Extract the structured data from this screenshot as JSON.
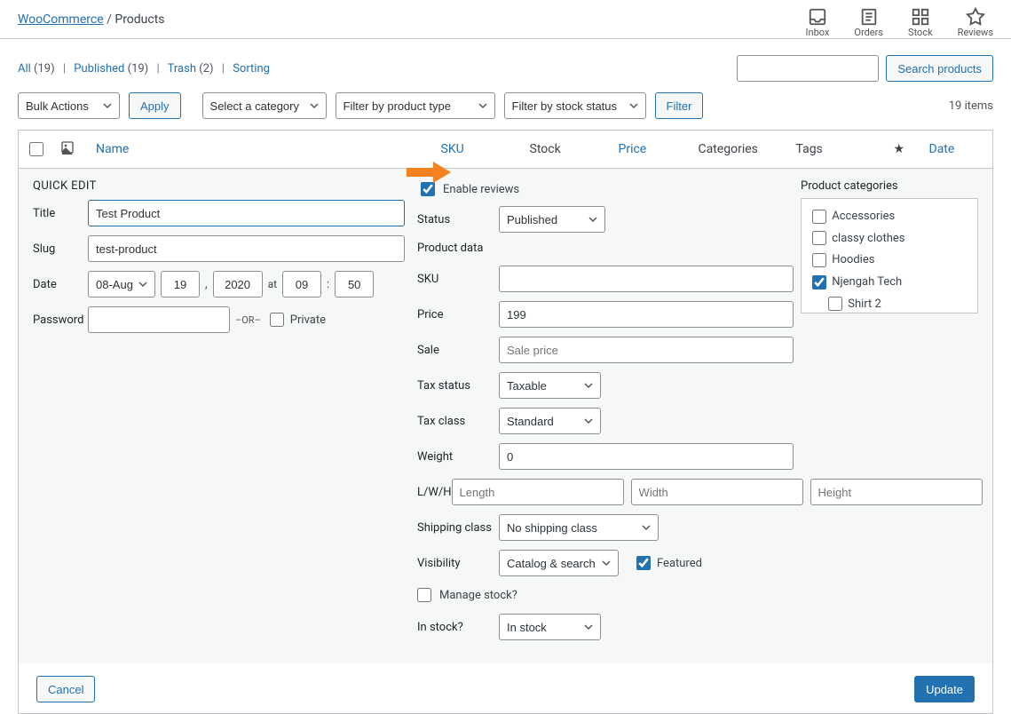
{
  "breadcrumb": {
    "root": "WooCommerce",
    "leaf": "Products"
  },
  "headicons": {
    "inbox": "Inbox",
    "orders": "Orders",
    "stock": "Stock",
    "reviews": "Reviews"
  },
  "subsub": {
    "all": "All",
    "all_count": "(19)",
    "published": "Published",
    "published_count": "(19)",
    "trash": "Trash",
    "trash_count": "(2)",
    "sorting": "Sorting"
  },
  "search_button": "Search products",
  "items_count": "19 items",
  "bulk": "Bulk Actions",
  "apply": "Apply",
  "filter_cat": "Select a category",
  "filter_type": "Filter by product type",
  "filter_stock": "Filter by stock status",
  "filter_btn": "Filter",
  "cols": {
    "name": "Name",
    "sku": "SKU",
    "stock": "Stock",
    "price": "Price",
    "categories": "Categories",
    "tags": "Tags",
    "date": "Date"
  },
  "qe_title": "QUICK EDIT",
  "left": {
    "title_lbl": "Title",
    "title_val": "Test Product",
    "slug_lbl": "Slug",
    "slug_val": "test-product",
    "date_lbl": "Date",
    "month": "08-Aug",
    "day": "19",
    "year": "2020",
    "at": "at",
    "hour": "09",
    "min": "50",
    "pass_lbl": "Password",
    "or": "–OR–",
    "private": "Private"
  },
  "mid": {
    "enable_reviews": "Enable reviews",
    "status_lbl": "Status",
    "status_val": "Published",
    "pd_title": "Product data",
    "sku_lbl": "SKU",
    "sku_val": "",
    "price_lbl": "Price",
    "price_val": "199",
    "sale_lbl": "Sale",
    "sale_ph": "Sale price",
    "tax_status_lbl": "Tax status",
    "tax_status_val": "Taxable",
    "tax_class_lbl": "Tax class",
    "tax_class_val": "Standard",
    "weight_lbl": "Weight",
    "weight_val": "0",
    "lwh_lbl": "L/W/H",
    "l_ph": "Length",
    "w_ph": "Width",
    "h_ph": "Height",
    "ship_lbl": "Shipping class",
    "ship_val": "No shipping class",
    "vis_lbl": "Visibility",
    "vis_val": "Catalog & search",
    "featured": "Featured",
    "manage": "Manage stock?",
    "instock_lbl": "In stock?",
    "instock_val": "In stock"
  },
  "cats": {
    "title": "Product categories",
    "items": [
      "Accessories",
      "classy clothes",
      "Hoodies",
      "Njengah Tech",
      "Shirt 2"
    ]
  },
  "cancel": "Cancel",
  "update": "Update"
}
